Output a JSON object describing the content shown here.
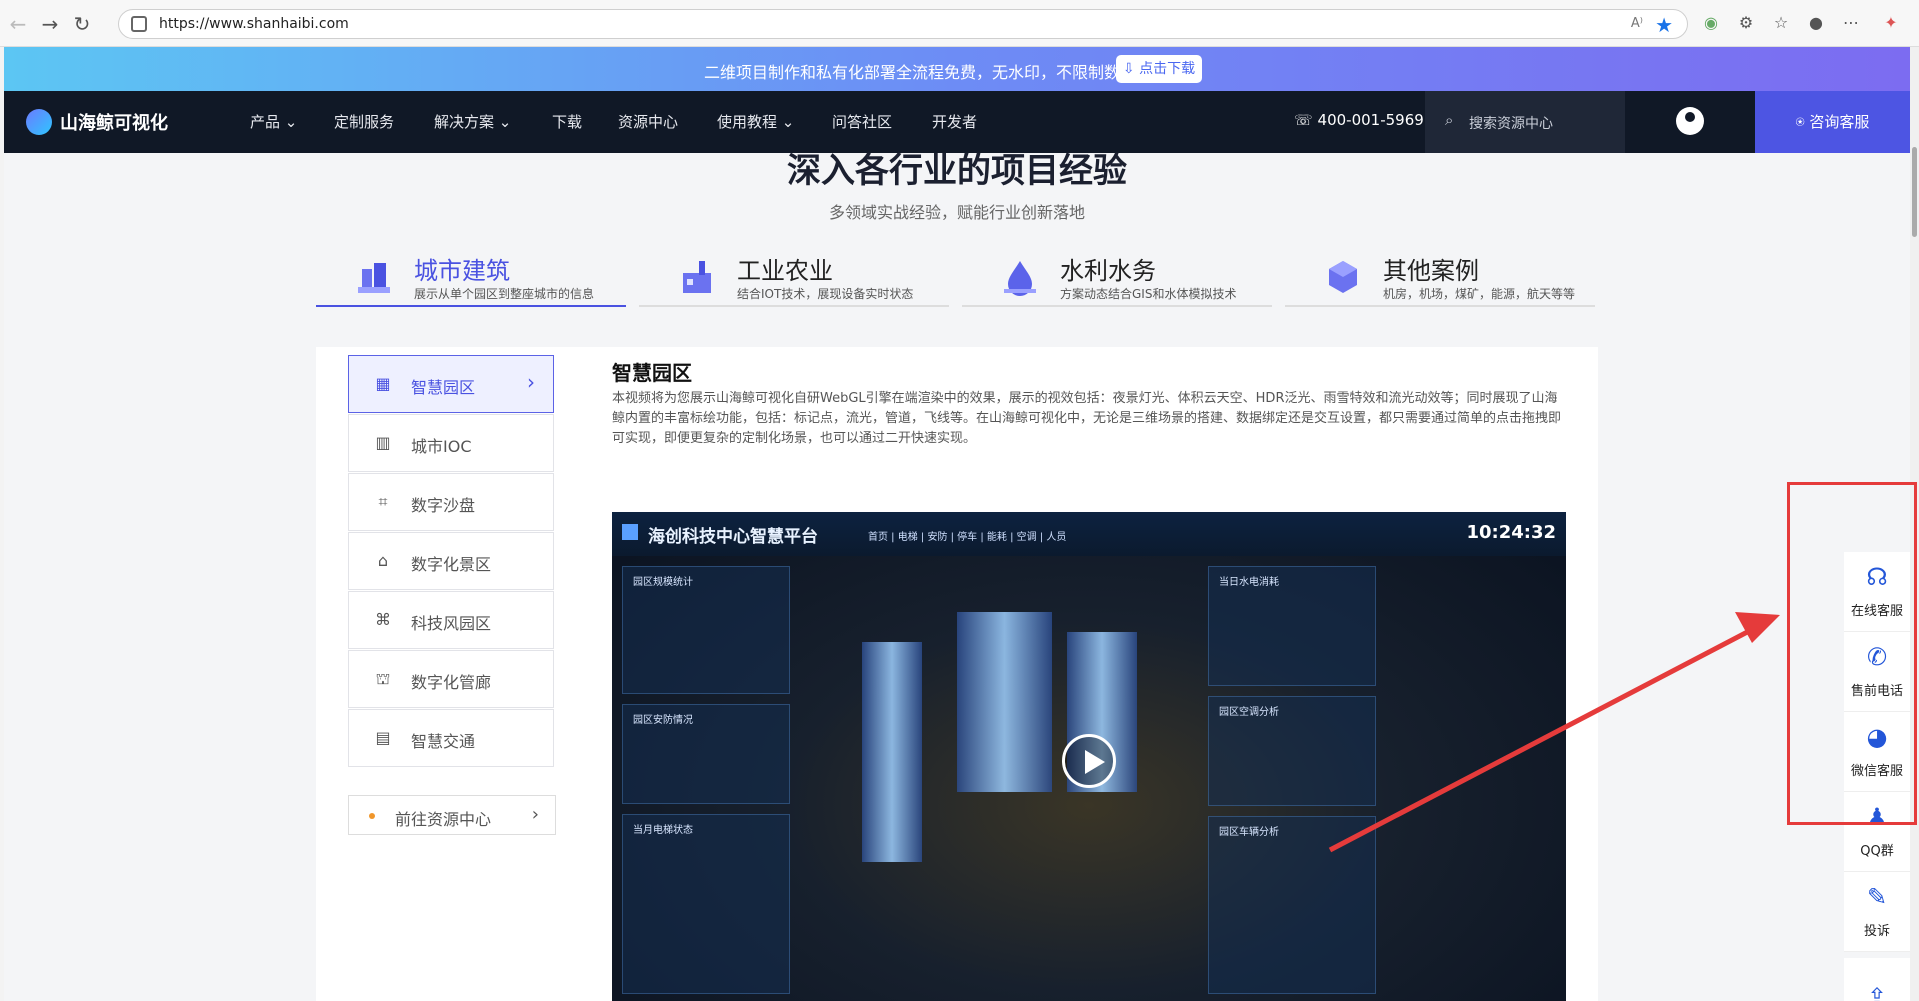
{
  "browser": {
    "url": "https://www.shanhaibi.com"
  },
  "promo": {
    "text": "二维项目制作和私有化部署全流程免费，无水印，不限制数量",
    "button": "⇩ 点击下载"
  },
  "nav": {
    "logo": "山海鲸可视化",
    "items": [
      "产品 ⌄",
      "定制服务",
      "解决方案 ⌄",
      "下载",
      "资源中心",
      "使用教程 ⌄",
      "问答社区",
      "开发者"
    ],
    "phone": "☏ 400-001-5969",
    "search_placeholder": "搜索资源中心",
    "consult": "⍟ 咨询客服"
  },
  "section": {
    "title": "深入各行业的项目经验",
    "subtitle": "多领域实战经验，赋能行业创新落地"
  },
  "tabs": [
    {
      "title": "城市建筑",
      "desc": "展示从单个园区到整座城市的信息"
    },
    {
      "title": "工业农业",
      "desc": "结合IOT技术，展现设备实时状态"
    },
    {
      "title": "水利水务",
      "desc": "方案动态结合GIS和水体模拟技术"
    },
    {
      "title": "其他案例",
      "desc": "机房，机场，煤矿，能源，航天等等"
    }
  ],
  "sidebar": {
    "items": [
      "智慧园区",
      "城市IOC",
      "数字沙盘",
      "数字化景区",
      "科技风园区",
      "数字化管廊",
      "智慧交通"
    ],
    "resource_button": "前往资源中心"
  },
  "content": {
    "title": "智慧园区",
    "description": "本视频将为您展示山海鲸可视化自研WebGL引擎在端渲染中的效果，展示的视效包括：夜景灯光、体积云天空、HDR泛光、雨雪特效和流光动效等；同时展现了山海鲸内置的丰富标绘功能，包括：标记点，流光，管道，飞线等。在山海鲸可视化中，无论是三维场景的搭建、数据绑定还是交互设置，都只需要通过简单的点击拖拽即可实现，即便更复杂的定制化场景，也可以通过二开快速实现。"
  },
  "dashboard": {
    "title": "海创科技中心智慧平台",
    "menu": "首页 | 电梯 | 安防 | 停车 | 能耗 | 空调 | 人员",
    "time": "10:24:32",
    "cards": [
      "园区规模统计",
      "园区安防情况",
      "当月电梯状态",
      "当日水电消耗",
      "园区空调分析",
      "园区车辆分析"
    ]
  },
  "float_bar": {
    "items": [
      {
        "label": "在线客服",
        "icon": "headset-icon"
      },
      {
        "label": "售前电话",
        "icon": "phone-icon"
      },
      {
        "label": "微信客服",
        "icon": "wechat-icon"
      },
      {
        "label": "QQ群",
        "icon": "qq-icon"
      },
      {
        "label": "投诉",
        "icon": "complaint-icon"
      }
    ]
  },
  "colors": {
    "accent": "#4a52e1",
    "nav_bg": "#101826",
    "highlight": "#e53b3b"
  }
}
